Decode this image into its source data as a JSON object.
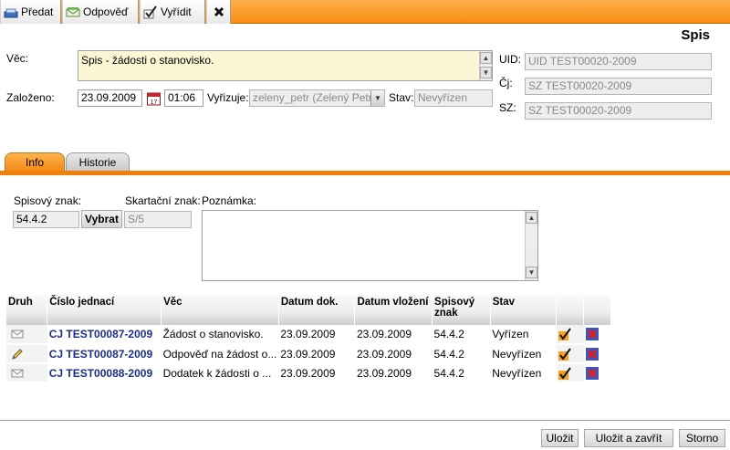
{
  "toolbar": {
    "predat_label": "Předat",
    "odpoved_label": "Odpověď",
    "vyridit_label": "Vyřídit"
  },
  "page_title": "Spis",
  "form": {
    "vec_label": "Věc:",
    "vec_value": "Spis - žádosti o stanovisko.",
    "zalozeno_label": "Založeno:",
    "zalozeno_date": "23.09.2009",
    "zalozeno_time": "01:06",
    "vyrizuje_label": "Vyřizuje:",
    "vyrizuje_value": "zeleny_petr (Zelený Petr)",
    "stav_label": "Stav:",
    "stav_value": "Nevyřízen",
    "uid_label": "UID:",
    "uid_value": "UID TEST00020-2009",
    "cj_label": "Čj:",
    "cj_value": "SZ TEST00020-2009",
    "sz_label": "SZ:",
    "sz_value": "SZ TEST00020-2009"
  },
  "tabs": [
    {
      "label": "Info",
      "active": true
    },
    {
      "label": "Historie",
      "active": false
    }
  ],
  "info": {
    "spisovy_znak_label": "Spisový znak:",
    "spisovy_znak_value": "54.4.2",
    "vybrat_label": "Vybrat",
    "skartacni_label": "Skartační znak:",
    "skartacni_value": "S/5",
    "poznamka_label": "Poznámka:",
    "poznamka_value": ""
  },
  "grid": {
    "headers": [
      "Druh",
      "Číslo jednací",
      "Věc",
      "Datum dok.",
      "Datum vložení",
      "Spisový znak",
      "Stav",
      "",
      ""
    ],
    "rows": [
      {
        "druh_icon": "envelope-icon",
        "cislo": "CJ TEST00087-2009",
        "vec": "Žádost o stanovisko.",
        "datum_dok": "23.09.2009",
        "datum_vlozeni": "23.09.2009",
        "znak": "54.4.2",
        "stav": "Vyřízen"
      },
      {
        "druh_icon": "pencil-icon",
        "cislo": "CJ TEST00087-2009",
        "vec": "Odpověď na žádost o...",
        "datum_dok": "23.09.2009",
        "datum_vlozeni": "23.09.2009",
        "znak": "54.4.2",
        "stav": "Nevyřízen"
      },
      {
        "druh_icon": "envelope-icon",
        "cislo": "CJ TEST00088-2009",
        "vec": "Dodatek k žádosti o ...",
        "datum_dok": "23.09.2009",
        "datum_vlozeni": "23.09.2009",
        "znak": "54.4.2",
        "stav": "Nevyřízen"
      }
    ]
  },
  "footer": {
    "ulozit_label": "Uložit",
    "ulozit_zavrit_label": "Uložit a zavřít",
    "storno_label": "Storno"
  },
  "colors": {
    "accent": "#f78d12",
    "link": "#1b2f88"
  }
}
